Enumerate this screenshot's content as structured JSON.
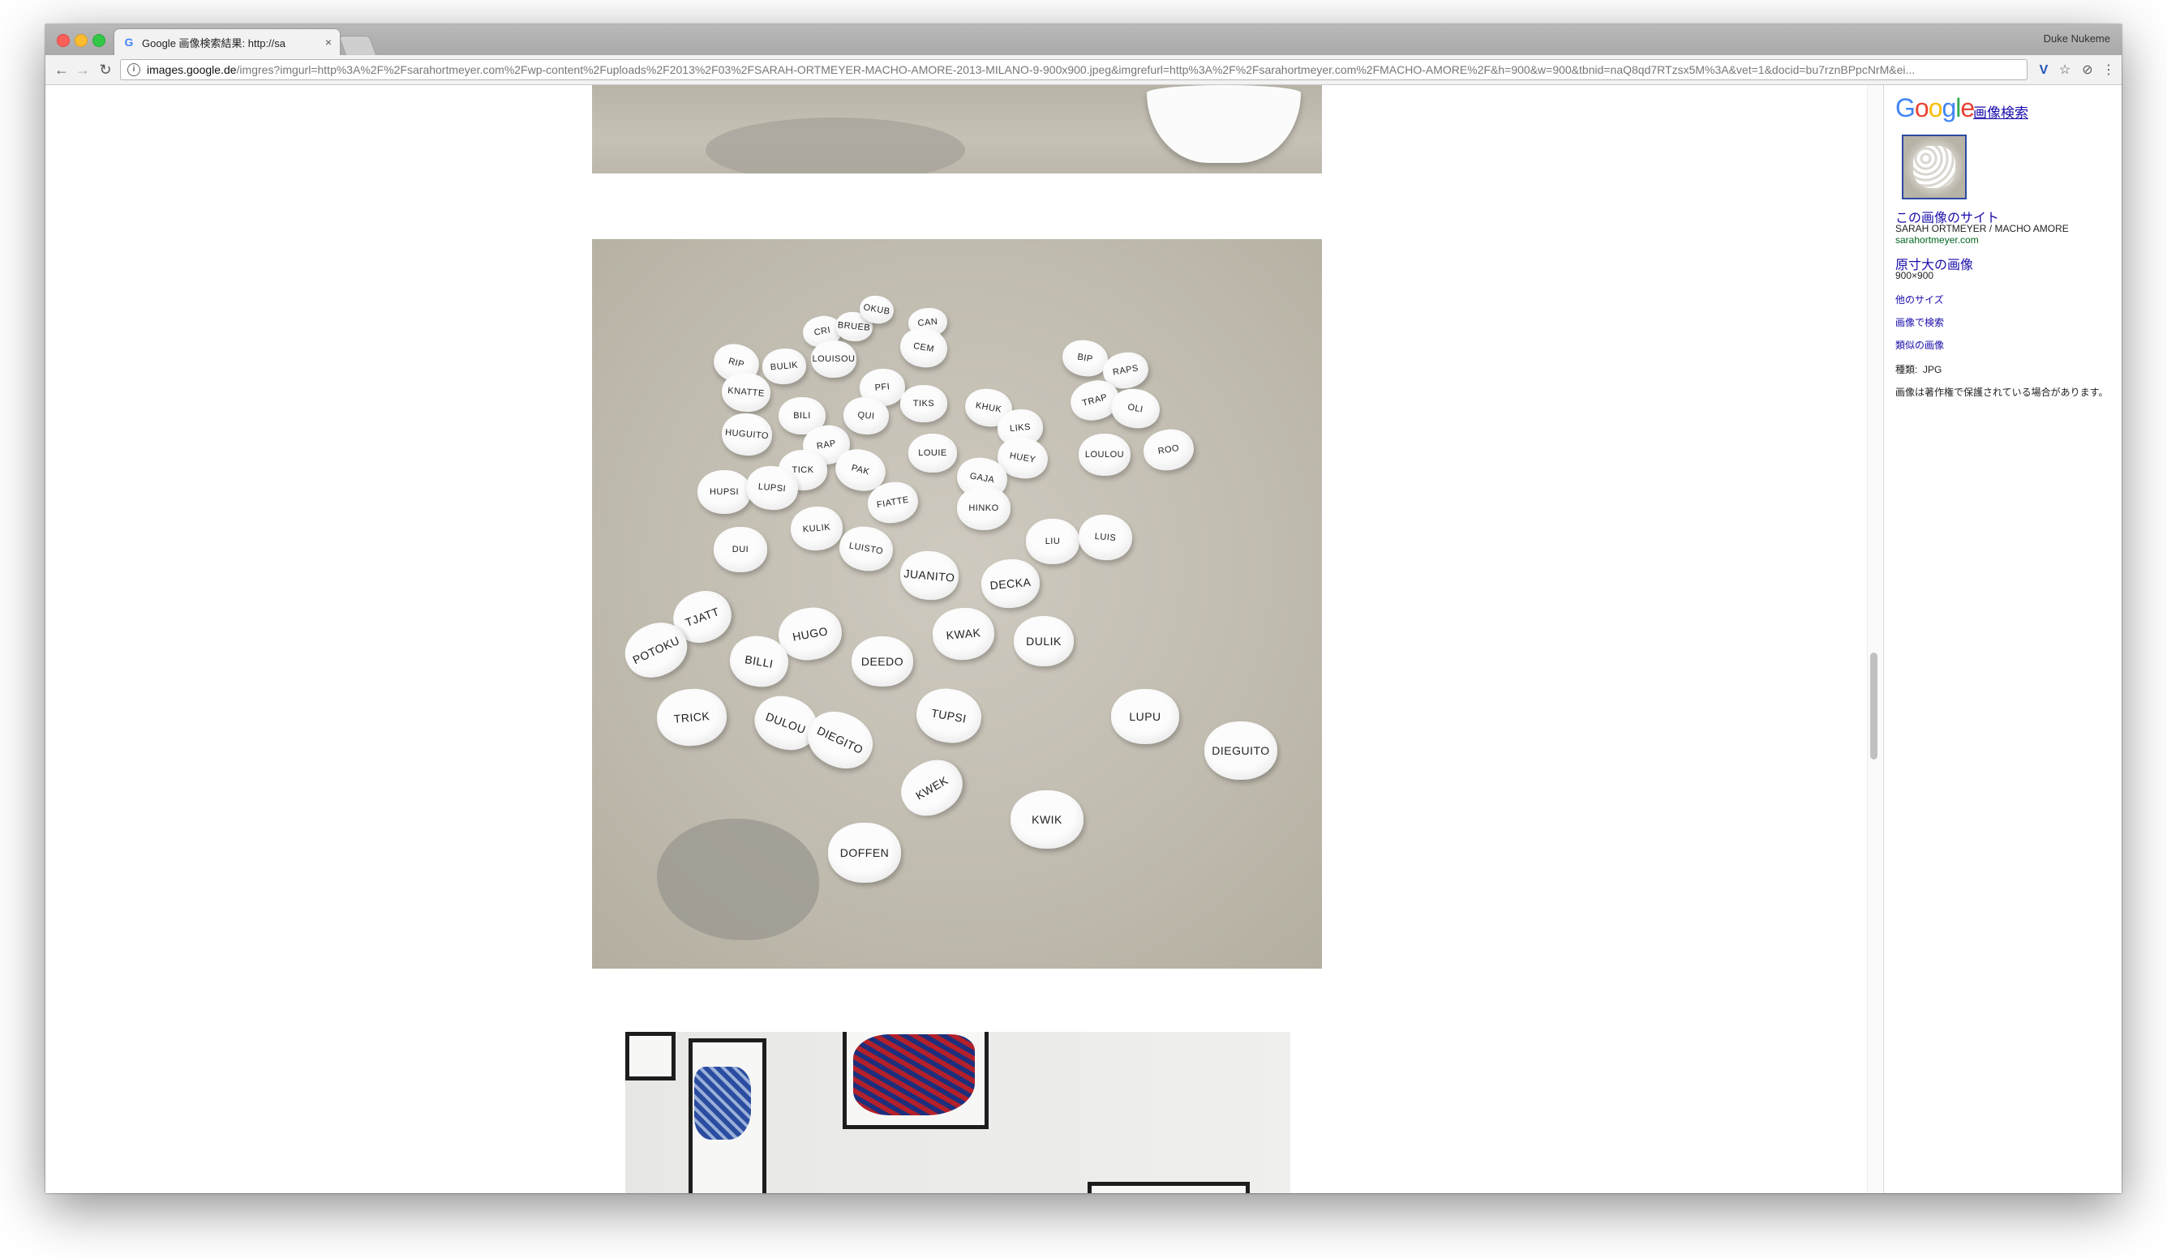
{
  "browser": {
    "tab_title": "Google 画像検索結果: http://sa",
    "tab_close": "×",
    "user_name": "Duke Nukeme",
    "url_domain": "images.google.de",
    "url_path": "/imgres?imgurl=http%3A%2F%2Fsarahortmeyer.com%2Fwp-content%2Fuploads%2F2013%2F03%2FSARAH-ORTMEYER-MACHO-AMORE-2013-MILANO-9-900x900.jpeg&imgrefurl=http%3A%2F%2Fsarahortmeyer.com%2FMACHO-AMORE%2F&h=900&w=900&tbnid=naQ8qd7RTzsx5M%3A&vet=1&docid=bu7rznBPpcNrM&ei...",
    "icons": {
      "back": "←",
      "forward": "→",
      "reload": "↻",
      "info": "i",
      "extension_v": "V",
      "star": "☆",
      "extension": "⊘",
      "menu": "⋮"
    }
  },
  "main_image": {
    "hats": [
      {
        "label": "CRI"
      },
      {
        "label": "BRUEB"
      },
      {
        "label": "CAN"
      },
      {
        "label": "OKUB"
      },
      {
        "label": "RIP"
      },
      {
        "label": "BULIK"
      },
      {
        "label": "LOUISOU"
      },
      {
        "label": "CEM"
      },
      {
        "label": "BIP"
      },
      {
        "label": "RAPS"
      },
      {
        "label": "KNATTE"
      },
      {
        "label": "PFI"
      },
      {
        "label": "TIKS"
      },
      {
        "label": "KHUK"
      },
      {
        "label": "TRAP"
      },
      {
        "label": "OLI"
      },
      {
        "label": "BILI"
      },
      {
        "label": "QUI"
      },
      {
        "label": "LIKS"
      },
      {
        "label": "HUGUITO"
      },
      {
        "label": "RAP"
      },
      {
        "label": "LOUIE"
      },
      {
        "label": "HUEY"
      },
      {
        "label": "LOULOU"
      },
      {
        "label": "ROO"
      },
      {
        "label": "PAK"
      },
      {
        "label": "TICK"
      },
      {
        "label": "GAJA"
      },
      {
        "label": "HUPSI"
      },
      {
        "label": "LUPSI"
      },
      {
        "label": "FIATTE"
      },
      {
        "label": "HINKO"
      },
      {
        "label": "KULIK"
      },
      {
        "label": "LUISTO"
      },
      {
        "label": "LIU"
      },
      {
        "label": "LUIS"
      },
      {
        "label": "DUI"
      },
      {
        "label": "JUANITO"
      },
      {
        "label": "DECKA"
      },
      {
        "label": "TJATT"
      },
      {
        "label": "HUGO"
      },
      {
        "label": "POTOKU"
      },
      {
        "label": "BILLI"
      },
      {
        "label": "KWAK"
      },
      {
        "label": "DULIK"
      },
      {
        "label": "DEEDO"
      },
      {
        "label": "TRICK"
      },
      {
        "label": "DULOU"
      },
      {
        "label": "DIEGITO"
      },
      {
        "label": "TUPSI"
      },
      {
        "label": "LUPU"
      },
      {
        "label": "DIEGUITO"
      },
      {
        "label": "KWEK"
      },
      {
        "label": "KWIK"
      },
      {
        "label": "DOFFEN"
      }
    ]
  },
  "side_panel": {
    "logo": {
      "g1": "G",
      "o1": "o",
      "o2": "o",
      "g2": "g",
      "l": "l",
      "e": "e"
    },
    "image_search_link": "画像検索",
    "site_link": "この画像のサイト",
    "site_title": "SARAH ORTMEYER / MACHO AMORE",
    "site_domain": "sarahortmeyer.com",
    "full_size_link": "原寸大の画像",
    "dimensions": "900×900",
    "other_sizes": "他のサイズ",
    "search_by_image": "画像で検索",
    "similar_images": "類似の画像",
    "type_label": "種類:",
    "type_value": "JPG",
    "copyright_notice": "画像は著作権で保護されている場合があります。"
  }
}
